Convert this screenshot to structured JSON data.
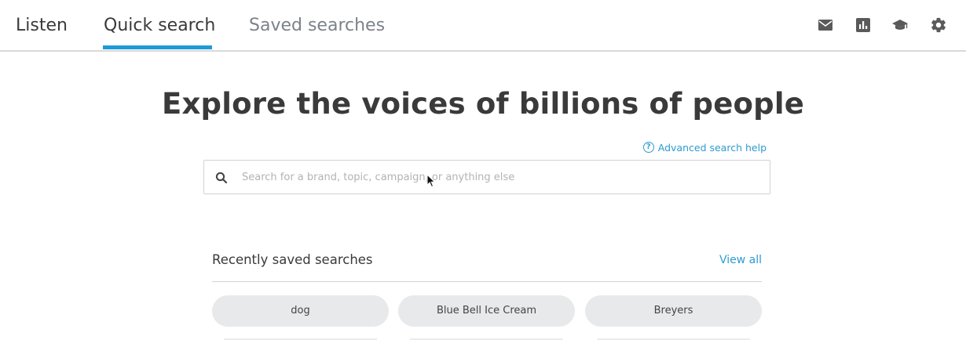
{
  "nav": {
    "tabs": [
      {
        "label": "Listen"
      },
      {
        "label": "Quick search"
      },
      {
        "label": "Saved searches"
      }
    ],
    "active_tab": "Quick search",
    "icons": [
      "mail-icon",
      "bar-chart-icon",
      "graduation-cap-icon",
      "gear-icon"
    ]
  },
  "hero": {
    "title": "Explore the voices of billions of people"
  },
  "help": {
    "icon_glyph": "?",
    "label": "Advanced search help"
  },
  "search": {
    "value": "",
    "placeholder": "Search for a brand, topic, campaign, or anything else"
  },
  "recent": {
    "title": "Recently saved searches",
    "view_all": "View all",
    "items": [
      {
        "label": "dog"
      },
      {
        "label": "Blue Bell Ice Cream"
      },
      {
        "label": "Breyers"
      }
    ]
  },
  "colors": {
    "accent": "#1e9ad6",
    "link": "#2e9bd1",
    "pill_bg": "#e8e9ea",
    "icon": "#5a5a5a"
  }
}
